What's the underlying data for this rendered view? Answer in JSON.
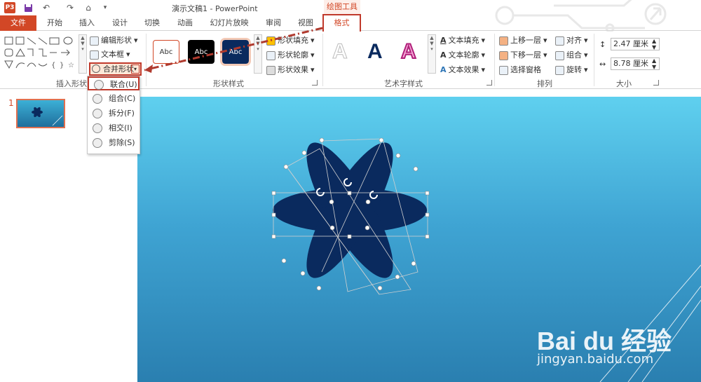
{
  "titlebar": {
    "app_badge": "P3",
    "title": "演示文稿1 - PowerPoint",
    "context_group": "绘图工具"
  },
  "tabs": [
    {
      "label": "文件"
    },
    {
      "label": "开始"
    },
    {
      "label": "插入"
    },
    {
      "label": "设计"
    },
    {
      "label": "切换"
    },
    {
      "label": "动画"
    },
    {
      "label": "幻灯片放映"
    },
    {
      "label": "审阅"
    },
    {
      "label": "视图"
    },
    {
      "label": "格式"
    }
  ],
  "ribbon": {
    "insert_shapes": {
      "label": "插入形状",
      "edit_shape": "编辑形状",
      "text_box": "文本框",
      "merge_shapes": "合并形状"
    },
    "shape_styles": {
      "label": "形状样式",
      "samples": [
        "Abc",
        "Abc",
        "Abc"
      ],
      "fill": "形状填充",
      "outline": "形状轮廓",
      "effects": "形状效果"
    },
    "wordart": {
      "label": "艺术字样式",
      "samples": [
        "A",
        "A",
        "A"
      ],
      "text_fill": "文本填充",
      "text_outline": "文本轮廓",
      "text_effects": "文本效果"
    },
    "arrange": {
      "label": "排列",
      "bring_forward": "上移一层",
      "send_backward": "下移一层",
      "selection_pane": "选择窗格",
      "align": "对齐",
      "group": "组合",
      "rotate": "旋转"
    },
    "size": {
      "label": "大小",
      "height": "2.47 厘米",
      "width": "8.78 厘米"
    }
  },
  "merge_menu": {
    "items": [
      {
        "label": "联合(U)"
      },
      {
        "label": "组合(C)"
      },
      {
        "label": "拆分(F)"
      },
      {
        "label": "相交(I)"
      },
      {
        "label": "剪除(S)"
      }
    ]
  },
  "slides_pane": {
    "slide_number": "1"
  },
  "watermark": {
    "brand": "Bai du 经验",
    "url": "jingyan.baidu.com"
  },
  "colors": {
    "accent": "#d24726",
    "highlight": "#c0392b",
    "shape_fill": "#0a2a5e",
    "slide_top": "#5fd0ef",
    "slide_bottom": "#2a7fb0"
  }
}
